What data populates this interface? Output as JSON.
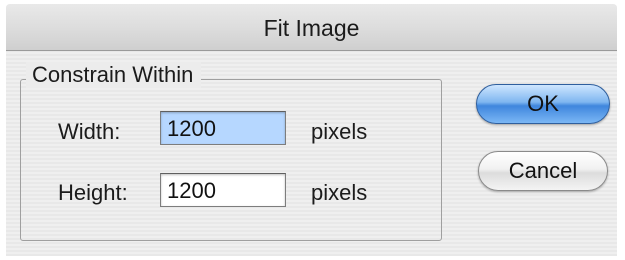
{
  "dialog": {
    "title": "Fit Image",
    "group_label": "Constrain Within",
    "width": {
      "label": "Width:",
      "value": "1200",
      "unit": "pixels",
      "focused": true
    },
    "height": {
      "label": "Height:",
      "value": "1200",
      "unit": "pixels",
      "focused": false
    },
    "ok_label": "OK",
    "cancel_label": "Cancel"
  },
  "colors": {
    "focus_field": "#b6d7ff",
    "default_button": "#5a9be6"
  }
}
